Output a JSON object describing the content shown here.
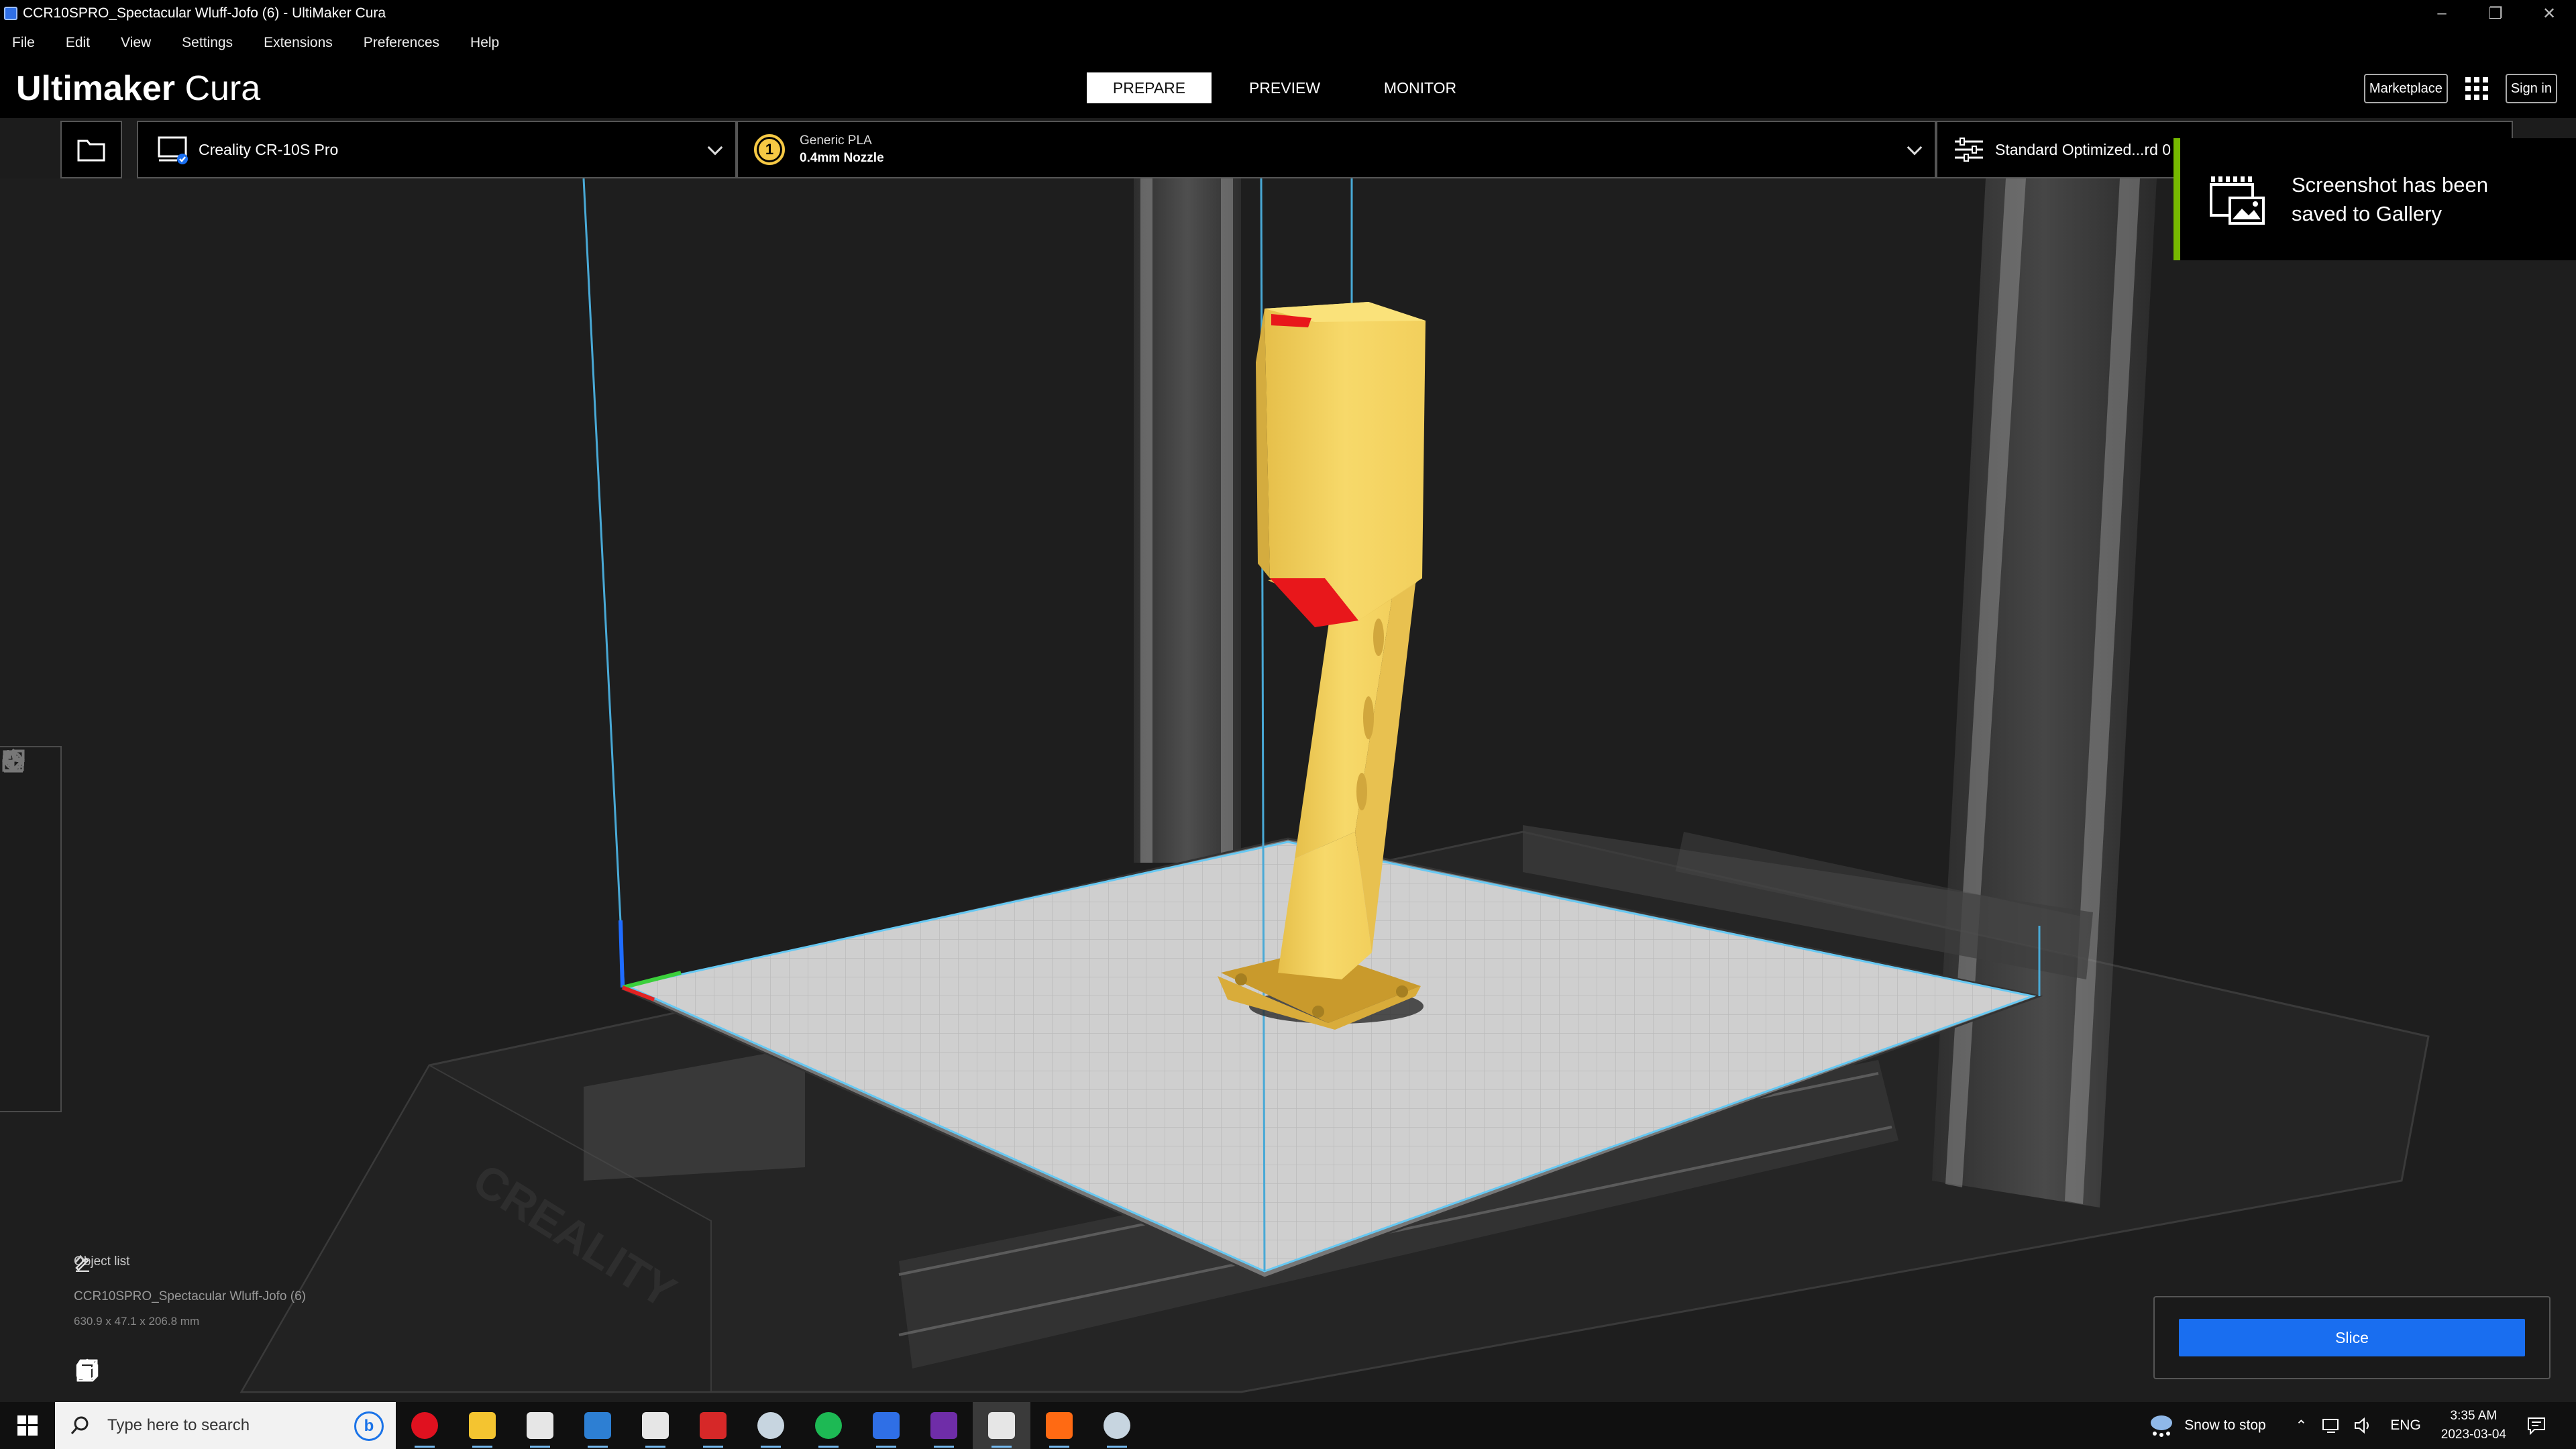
{
  "window": {
    "title": "CCR10SPRO_Spectacular Wluff-Jofo (6) - UltiMaker Cura",
    "controls": [
      "minimize",
      "restore",
      "close"
    ]
  },
  "menu": [
    "File",
    "Edit",
    "View",
    "Settings",
    "Extensions",
    "Preferences",
    "Help"
  ],
  "header": {
    "brand_bold": "Ultimaker",
    "brand_light": "Cura",
    "tabs": [
      {
        "label": "PREPARE",
        "active": true
      },
      {
        "label": "PREVIEW",
        "active": false
      },
      {
        "label": "MONITOR",
        "active": false
      }
    ],
    "marketplace_label": "Marketplace",
    "signin_label": "Sign in"
  },
  "toolbar": {
    "printer": "Creality CR-10S Pro",
    "material_name": "Generic PLA",
    "nozzle": "0.4mm Nozzle",
    "extruder_number": "1",
    "profile": "Standard Optimized...rd 0"
  },
  "notification": {
    "message": "Screenshot has been saved to Gallery"
  },
  "scene": {
    "build_plate_brand": "CREALITY",
    "model_color": "#f5d565",
    "overhang_color": "#e8171b"
  },
  "object_list": {
    "header": "Object list",
    "object_name": "CCR10SPRO_Spectacular Wluff-Jofo (6)",
    "dimensions": "630.9 x 47.1 x 206.8 mm"
  },
  "slice_button": "Slice",
  "taskbar": {
    "search_placeholder": "Type here to search",
    "apps": [
      {
        "name": "opera-icon",
        "color": "#e0111f"
      },
      {
        "name": "file-explorer-icon",
        "color": "#f4c430"
      },
      {
        "name": "sketchup-icon",
        "color": "#e6e6e6"
      },
      {
        "name": "microsoft-store-icon",
        "color": "#2d7fd3"
      },
      {
        "name": "logitech-ghub-icon",
        "color": "#e6e6e6"
      },
      {
        "name": "power-app-icon",
        "color": "#d62828"
      },
      {
        "name": "steam-icon",
        "color": "#c7d5e0"
      },
      {
        "name": "spotify-icon",
        "color": "#1db954"
      },
      {
        "name": "cura-icon",
        "color": "#2f6fe6"
      },
      {
        "name": "nzxt-cam-icon",
        "color": "#6f2da8"
      },
      {
        "name": "slicer-app-icon",
        "color": "#e6e6e6"
      },
      {
        "name": "arrow-app-icon",
        "color": "#ff6a13"
      },
      {
        "name": "steam-alt-icon",
        "color": "#c7d5e0"
      }
    ],
    "weather": "Snow to stop",
    "language": "ENG",
    "time": "3:35 AM",
    "date": "2023-03-04"
  }
}
